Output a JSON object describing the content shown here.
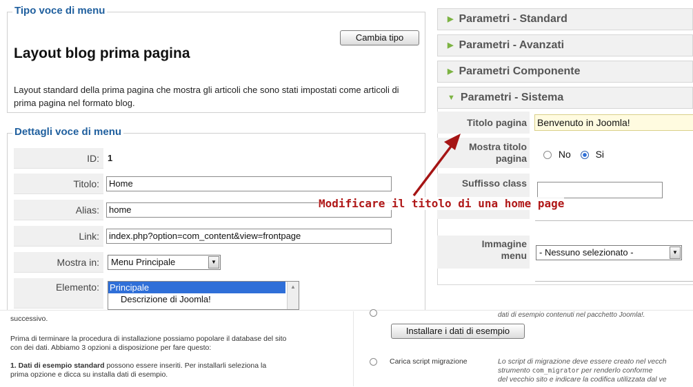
{
  "menu_type": {
    "legend": "Tipo voce di menu",
    "change_button": "Cambia tipo",
    "title": "Layout blog prima pagina",
    "description": "Layout standard della prima pagina che mostra gli articoli che sono stati impostati come articoli di prima pagina nel formato blog."
  },
  "details": {
    "legend": "Dettagli voce di menu",
    "id_label": "ID:",
    "id_value": "1",
    "title_label": "Titolo:",
    "title_value": "Home",
    "alias_label": "Alias:",
    "alias_value": "home",
    "link_label": "Link:",
    "link_value": "index.php?option=com_content&view=frontpage",
    "show_in_label": "Mostra in:",
    "show_in_value": "Menu Principale",
    "element_label": "Elemento:",
    "element_options": [
      "Principale",
      "Descrizione di Joomla!"
    ]
  },
  "params": {
    "standard": "Parametri - Standard",
    "advanced": "Parametri - Avanzati",
    "component": "Parametri Componente",
    "system": "Parametri - Sistema",
    "page_title_label": "Titolo pagina",
    "page_title_value": "Benvenuto in Joomla!",
    "show_title_label_1": "Mostra titolo",
    "show_title_label_2": "pagina",
    "radio_no": "No",
    "radio_yes": "Si",
    "radio_selected": "Si",
    "suffix_label": "Suffisso class",
    "image_label_1": "Immagine",
    "image_label_2": "menu",
    "image_value": "- Nessuno selezionato -"
  },
  "annotation": {
    "text": "Modificare il titolo di una home page",
    "color": "#b01818"
  },
  "install": {
    "line1": "successivo.",
    "para2_1": "Prima di terminare la procedura di installazione possiamo popolare il database del sito",
    "para2_2": "con dei dati. Abbiamo 3 opzioni a disposizione per fare questo:",
    "para3_bold": "1. Dati di esempio standard",
    "para3_rest": " possono essere inseriti. Per installarli seleziona la",
    "para3_2": "prima opzione e dicca su installa dati di esempio.",
    "right_top": "dati di esempio contenuti nel pacchetto Joomla!.",
    "install_button": "Installare i dati di esempio",
    "migration_label": "Carica script migrazione",
    "migration_desc_1": "Lo script di migrazione deve essere creato nel vecch",
    "migration_desc_2a": "strumento ",
    "migration_desc_2b": "com_migrator",
    "migration_desc_2c": " per renderlo conforme",
    "migration_desc_3": "del vecchio sito e indicare la codifica utilizzata dal ve"
  }
}
